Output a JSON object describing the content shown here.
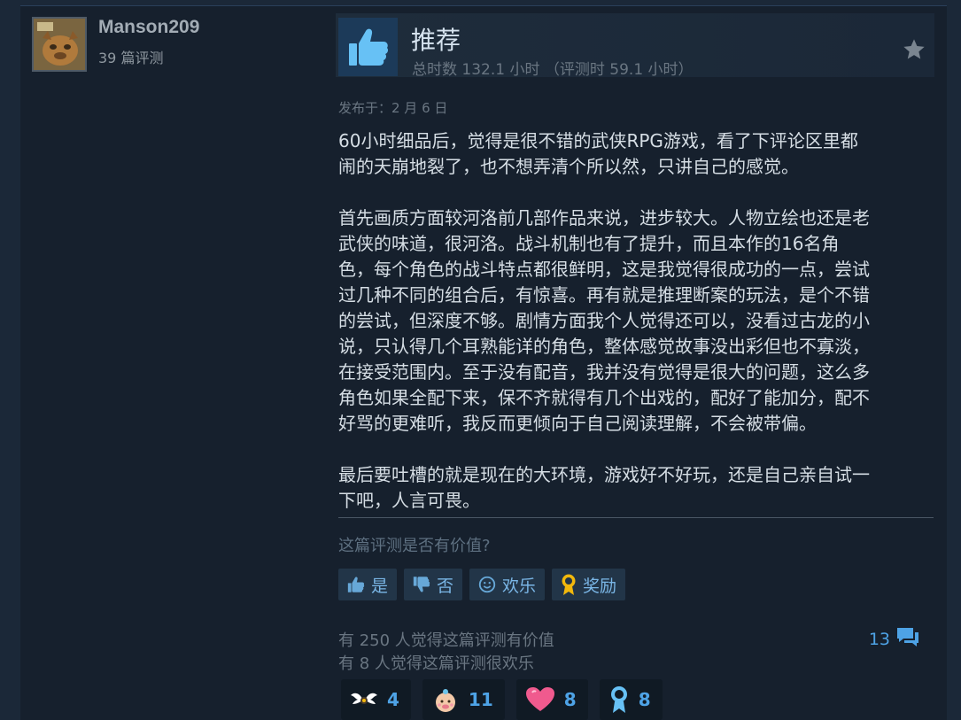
{
  "author": {
    "name": "Manson209",
    "review_count": "39 篇评测"
  },
  "review": {
    "verdict": "推荐",
    "hours": "总时数 132.1 小时 （评测时 59.1 小时）",
    "posted": "发布于：2 月 6 日",
    "body": "60小时细品后，觉得是很不错的武侠RPG游戏，看了下评论区里都\n闹的天崩地裂了，也不想弄清个所以然，只讲自己的感觉。\n\n首先画质方面较河洛前几部作品来说，进步较大。人物立绘也还是老\n武侠的味道，很河洛。战斗机制也有了提升，而且本作的16名角\n色，每个角色的战斗特点都很鲜明，这是我觉得很成功的一点，尝试\n过几种不同的组合后，有惊喜。再有就是推理断案的玩法，是个不错\n的尝试，但深度不够。剧情方面我个人觉得还可以，没看过古龙的小\n说，只认得几个耳熟能详的角色，整体感觉故事没出彩但也不寡淡，\n在接受范围内。至于没有配音，我并没有觉得是很大的问题，这么多\n角色如果全配下来，保不齐就得有几个出戏的，配好了能加分，配不\n好骂的更难听，我反而更倾向于自己阅读理解，不会被带偏。\n\n最后要吐槽的就是现在的大环境，游戏好不好玩，还是自己亲自试一\n下吧，人言可畏。"
  },
  "helpful_prompt": "这篇评测是否有价值?",
  "buttons": {
    "yes": "是",
    "no": "否",
    "funny": "欢乐",
    "award": "奖励"
  },
  "stats": {
    "helpful": "有 250 人觉得这篇评测有价值",
    "funny": "有 8 人觉得这篇评测很欢乐"
  },
  "comments_count": "13",
  "awards": [
    {
      "icon": "wings-award-icon",
      "count": "4"
    },
    {
      "icon": "baby-face-award-icon",
      "count": "11"
    },
    {
      "icon": "heart-award-icon",
      "count": "8"
    },
    {
      "icon": "medal-award-icon",
      "count": "8"
    }
  ],
  "colors": {
    "background": "#1b2838",
    "panel": "#16202d",
    "accent": "#4ea3e6",
    "thumb_box": "#1c3a59"
  }
}
